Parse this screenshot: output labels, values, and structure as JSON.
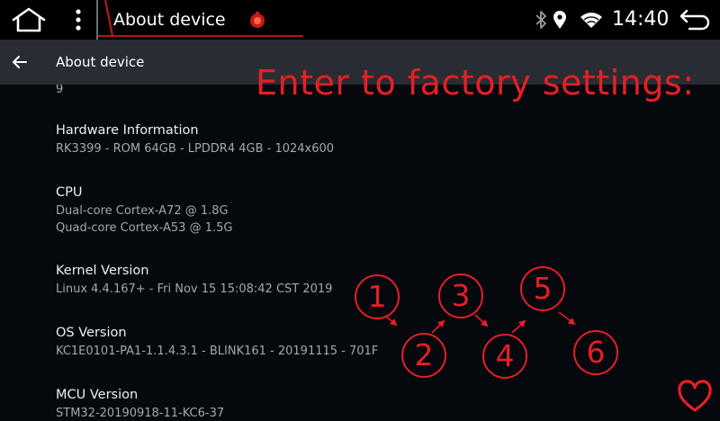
{
  "status_bar": {
    "title": "About device",
    "time": "14:40",
    "icons": [
      "home-icon",
      "menu-dots-icon",
      "app-badge-icon",
      "bluetooth-icon",
      "location-icon",
      "wifi-icon",
      "back-icon"
    ]
  },
  "toolbar": {
    "title": "About device",
    "icon": "arrow-left-icon"
  },
  "list": {
    "partial_top_value": "9",
    "items": [
      {
        "title": "Hardware Information",
        "values": [
          "RK3399 - ROM 64GB - LPDDR4 4GB - 1024x600"
        ]
      },
      {
        "title": "CPU",
        "values": [
          "Dual-core Cortex-A72 @ 1.8G",
          "Quad-core Cortex-A53 @ 1.5G"
        ]
      },
      {
        "title": "Kernel Version",
        "values": [
          "Linux 4.4.167+ - Fri Nov 15 15:08:42 CST 2019"
        ]
      },
      {
        "title": "OS Version",
        "values": [
          "KC1E0101-PA1-1.1.4.3.1 - BLINK161 - 20191115 - 701F"
        ]
      },
      {
        "title": "MCU Version",
        "values": [
          "STM32-20190918-11-KC6-37"
        ]
      }
    ]
  },
  "overlay": {
    "heading": "Enter to factory settings:",
    "steps": [
      "1",
      "2",
      "3",
      "4",
      "5",
      "6"
    ],
    "color": "#e81e25",
    "icon": "heart-icon"
  },
  "colors": {
    "background": "#05080d",
    "toolbar": "#292d33",
    "accent_red": "#e81e25"
  }
}
